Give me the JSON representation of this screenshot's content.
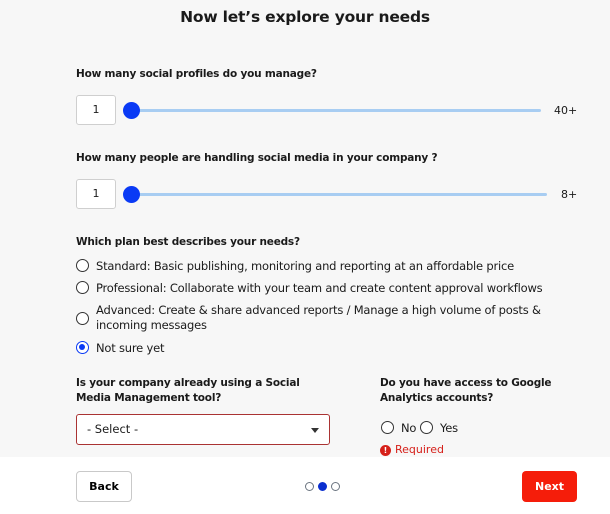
{
  "title": "Now let’s explore your needs",
  "profiles": {
    "label": "How many social profiles do you manage?",
    "value": "1",
    "max_label": "40+",
    "slider_fraction": 0.0
  },
  "people": {
    "label": "How many people are handling social media in your company ?",
    "value": "1",
    "max_label": "8+",
    "slider_fraction": 0.0
  },
  "plan": {
    "label": "Which plan best describes your needs?",
    "options": [
      {
        "line1": "Standard: Basic publishing, monitoring and reporting at an affordable price",
        "line2": "",
        "checked": false
      },
      {
        "line1": "Professional: Collaborate with your team and create content approval workflows",
        "line2": "",
        "checked": false
      },
      {
        "line1": "Advanced: Create & share advanced reports / Manage a high volume of posts &",
        "line2": "incoming messages",
        "checked": false
      },
      {
        "line1": "Not sure yet",
        "line2": "",
        "checked": true
      }
    ]
  },
  "tool": {
    "label_line1": "Is your company already using a Social",
    "label_line2": "Media Management tool?",
    "select_value": "- Select -"
  },
  "analytics": {
    "label_line1": "Do you have access to Google",
    "label_line2": "Analytics accounts?",
    "options": [
      "No",
      "Yes"
    ],
    "error": "Required",
    "error_icon": "!"
  },
  "footer": {
    "back_label": "Back",
    "next_label": "Next",
    "steps": 3,
    "current_step": 2
  },
  "colors": {
    "accent": "#0a3af5",
    "next_button": "#f51d0a",
    "error": "#d6201a"
  }
}
